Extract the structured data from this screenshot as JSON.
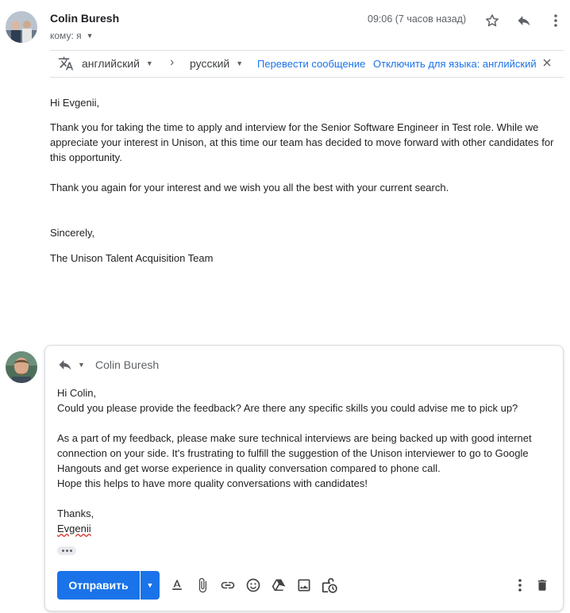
{
  "message": {
    "sender": "Colin Buresh",
    "to_line": "кому: я",
    "time": "09:06 (7 часов назад)",
    "translate_bar": {
      "from_lang": "английский",
      "to_lang": "русский",
      "translate_link": "Перевести сообщение",
      "disable_link": "Отключить для языка: английский"
    },
    "greeting": "Hi Evgenii,",
    "paragraph1": "Thank you for taking the time to apply and interview for the Senior Software Engineer in Test role. While we appreciate your interest in Unison, at this time our team has decided to move forward with other candidates for this opportunity.",
    "paragraph2": "Thank you again for your interest and we wish you all the best with your current search.",
    "closing": "Sincerely,",
    "signature": "The Unison Talent Acquisition Team"
  },
  "reply": {
    "recipient": "Colin Buresh",
    "line1": "Hi Colin,",
    "line2": "Could you please provide the feedback? Are there any specific skills you could advise me to pick up?",
    "paragraph": "As a part of my feedback, please make sure technical interviews are being backed up with good internet connection on your side. It's frustrating to fulfill the suggestion of the Unison interviewer to go to Google Hangouts and get worse experience in quality conversation compared to phone call.",
    "line3": "Hope this helps to have more quality conversations with candidates!",
    "thanks": "Thanks,",
    "name": "Evgenii",
    "send_label": "Отправить"
  },
  "icons": [
    "star-icon",
    "reply-icon",
    "more-vert-icon",
    "translate-icon",
    "chevron-right-icon",
    "close-icon",
    "format-text-icon",
    "attach-icon",
    "link-icon",
    "emoji-icon",
    "drive-icon",
    "photo-icon",
    "confidential-icon",
    "trash-icon"
  ],
  "colors": {
    "accent": "#1a73e8",
    "send_button": "#1a73e8",
    "muted": "#5f6368"
  }
}
